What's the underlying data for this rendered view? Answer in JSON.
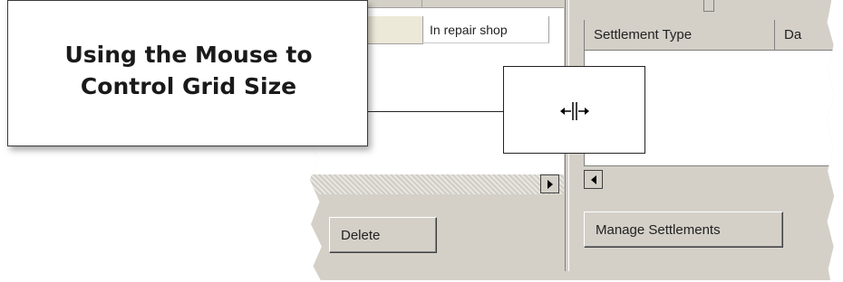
{
  "left_grid": {
    "cell_value": "In repair shop"
  },
  "right_grid": {
    "columns": [
      "Settlement Type",
      "Da"
    ]
  },
  "buttons": {
    "delete": "Delete",
    "manage_settlements": "Manage Settlements"
  },
  "callout": {
    "line1": "Using the Mouse to",
    "line2": "Control Grid Size"
  },
  "icons": [
    "right-arrow-icon",
    "left-arrow-icon",
    "resize-cursor-icon"
  ]
}
